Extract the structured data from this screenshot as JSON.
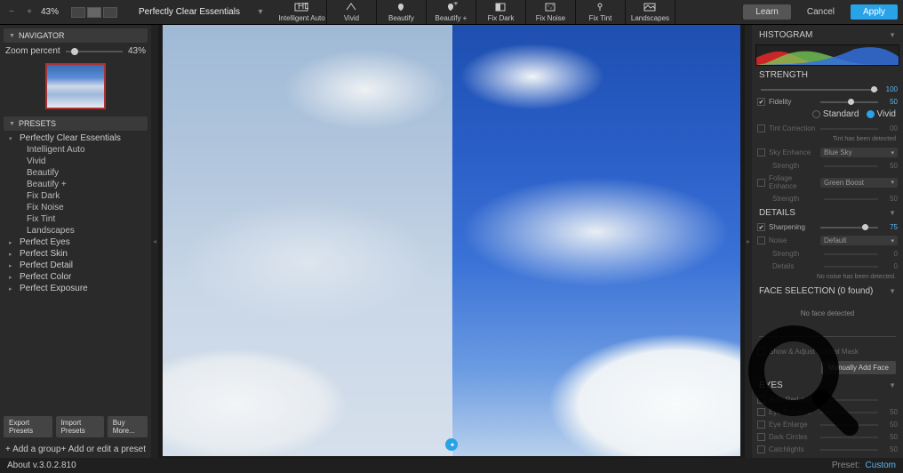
{
  "topbar": {
    "zoom_pct": "43%",
    "preset_name": "Perfectly Clear Essentials",
    "tools": [
      {
        "label": "Intelligent Auto"
      },
      {
        "label": "Vivid"
      },
      {
        "label": "Beautify"
      },
      {
        "label": "Beautify +"
      },
      {
        "label": "Fix Dark"
      },
      {
        "label": "Fix Noise"
      },
      {
        "label": "Fix Tint"
      },
      {
        "label": "Landscapes"
      }
    ],
    "learn": "Learn",
    "cancel": "Cancel",
    "apply": "Apply"
  },
  "left": {
    "navigator": "NAVIGATOR",
    "zoom_label": "Zoom percent",
    "zoom_val": "43%",
    "presets_hdr": "PRESETS",
    "group_open": "Perfectly Clear Essentials",
    "items": [
      "Intelligent Auto",
      "Vivid",
      "Beautify",
      "Beautify +",
      "Fix Dark",
      "Fix Noise",
      "Fix Tint",
      "Landscapes"
    ],
    "groups": [
      "Perfect Eyes",
      "Perfect Skin",
      "Perfect Detail",
      "Perfect Color",
      "Perfect Exposure"
    ],
    "export": "Export Presets",
    "import": "Import Presets",
    "buy": "Buy More...",
    "add_group": "+ Add a group",
    "add_preset": "+ Add or edit a preset"
  },
  "right": {
    "histogram": "HISTOGRAM",
    "strength": "STRENGTH",
    "strength_val": "100",
    "fidelity": "Fidelity",
    "fidelity_val": "50",
    "standard": "Standard",
    "vivid": "Vivid",
    "tint": "Tint Correction",
    "tint_val": "00",
    "tint_note": "Tint has been detected",
    "sky": "Sky Enhance",
    "sky_dd": "Blue Sky",
    "sky_str": "Strength",
    "sky_val": "50",
    "foliage": "Foliage Enhance",
    "foliage_dd": "Green Boost",
    "foliage_str": "Strength",
    "foliage_val": "50",
    "details": "DETAILS",
    "sharp": "Sharpening",
    "sharp_val": "75",
    "noise": "Noise",
    "noise_dd": "Default",
    "noise_str": "Strength",
    "noise_str_val": "0",
    "noise_det": "Details",
    "noise_det_val": "0",
    "noise_note": "No noise has been detected.",
    "face_hdr": "FACE SELECTION (0 found)",
    "face_none": "No face detected",
    "face_show": "Show & Adjust Control Mask",
    "face_manual": "Manually Add Face",
    "eyes_hdr": "EYES",
    "eye_rows": [
      {
        "label": "Auto Red-eye",
        "val": ""
      },
      {
        "label": "Eye Enhance",
        "val": "50"
      },
      {
        "label": "Eye Enlarge",
        "val": "50"
      },
      {
        "label": "Dark Circles",
        "val": "50"
      },
      {
        "label": "Catchlights",
        "val": "50"
      }
    ]
  },
  "footer": {
    "about": "About v.3.0.2.810",
    "preset_lbl": "Preset:",
    "preset_val": "Custom"
  }
}
